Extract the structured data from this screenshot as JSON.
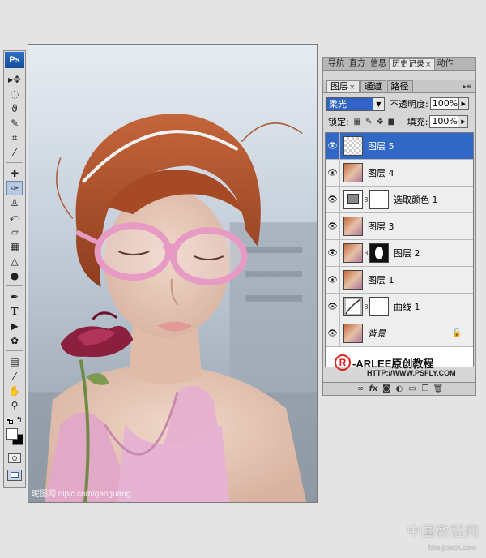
{
  "toolbox": {
    "logo": "Ps",
    "tools": [
      {
        "name": "move-tool",
        "glyph": "▸✥"
      },
      {
        "name": "marquee-tool",
        "glyph": "◌"
      },
      {
        "name": "lasso-tool",
        "glyph": "ϑ"
      },
      {
        "name": "magic-wand-tool",
        "glyph": "✎"
      },
      {
        "name": "crop-tool",
        "glyph": "⌗"
      },
      {
        "name": "eyedropper-tool",
        "glyph": "⁄"
      },
      {
        "name": "healing-brush-tool",
        "glyph": "✚"
      },
      {
        "name": "brush-tool",
        "glyph": "✑"
      },
      {
        "name": "clone-stamp-tool",
        "glyph": "♙"
      },
      {
        "name": "history-brush-tool",
        "glyph": "⤺"
      },
      {
        "name": "eraser-tool",
        "glyph": "▱"
      },
      {
        "name": "gradient-tool",
        "glyph": "▦"
      },
      {
        "name": "blur-tool",
        "glyph": "△"
      },
      {
        "name": "dodge-tool",
        "glyph": "●"
      },
      {
        "name": "pen-tool",
        "glyph": "✒"
      },
      {
        "name": "type-tool",
        "glyph": "T"
      },
      {
        "name": "path-selection-tool",
        "glyph": "▶"
      },
      {
        "name": "shape-tool",
        "glyph": "✿"
      },
      {
        "name": "notes-tool",
        "glyph": "▤"
      },
      {
        "name": "color-sampler-tool",
        "glyph": "⁄"
      },
      {
        "name": "hand-tool",
        "glyph": "✋"
      },
      {
        "name": "zoom-tool",
        "glyph": "⚲"
      }
    ]
  },
  "document": {
    "watermark": "昵图网 nipic.com/ganguang"
  },
  "panels": {
    "top_tabs": [
      "导航",
      "直方",
      "信息",
      "历史记录",
      "动作"
    ],
    "layer_tabs": [
      "图层",
      "通道",
      "路径"
    ],
    "blend_mode": "柔光",
    "opacity_label": "不透明度:",
    "opacity_value": "100%",
    "lock_label": "锁定:",
    "fill_label": "填充:",
    "fill_value": "100%",
    "layers": [
      {
        "name": "图层 5",
        "selected": true
      },
      {
        "name": "图层 4"
      },
      {
        "name": "选取颜色 1"
      },
      {
        "name": "图层 3"
      },
      {
        "name": "图层 2"
      },
      {
        "name": "图层 1"
      },
      {
        "name": "曲线 1"
      },
      {
        "name": "背景"
      }
    ],
    "brand_text": "-ARLEE原创教程",
    "brand_url": "HTTP://WWW.PSFLY.COM",
    "bottom_icons": [
      "link-icon",
      "fx-icon",
      "mask-icon",
      "adjustment-icon",
      "folder-icon",
      "new-layer-icon",
      "trash-icon"
    ]
  },
  "site": {
    "mark": "中国教程网",
    "url": "bbs.jcwcn.com"
  }
}
